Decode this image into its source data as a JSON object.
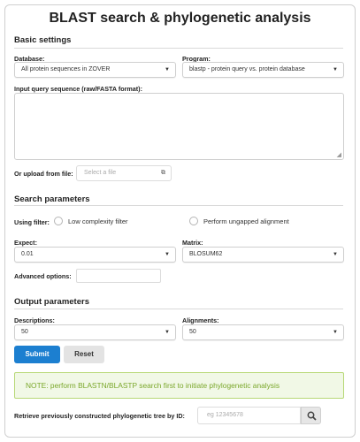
{
  "title": "BLAST search & phylogenetic analysis",
  "basic": {
    "heading": "Basic settings",
    "database_label": "Database:",
    "database_value": "All protein sequences in ZOVER",
    "program_label": "Program:",
    "program_value": "blastp - protein query vs. protein database",
    "query_label": "Input query sequence (raw/FASTA format):",
    "query_value": "",
    "upload_label": "Or upload from file:",
    "upload_placeholder": "Select a file",
    "upload_icon": "copy-icon"
  },
  "search": {
    "heading": "Search parameters",
    "filter_label": "Using filter:",
    "low_complexity_label": "Low complexity filter",
    "low_complexity_checked": false,
    "ungapped_label": "Perform ungapped alignment",
    "ungapped_checked": false,
    "expect_label": "Expect:",
    "expect_value": "0.01",
    "matrix_label": "Matrix:",
    "matrix_value": "BLOSUM62",
    "advanced_label": "Advanced options:",
    "advanced_value": ""
  },
  "output": {
    "heading": "Output parameters",
    "descriptions_label": "Descriptions:",
    "descriptions_value": "50",
    "alignments_label": "Alignments:",
    "alignments_value": "50"
  },
  "buttons": {
    "submit": "Submit",
    "reset": "Reset"
  },
  "note": "NOTE: perform BLASTN/BLASTP search first to initiate phylogenetic analysis",
  "retrieve": {
    "label": "Retrieve previously constructed phylogenetic tree by ID:",
    "placeholder": "eg 12345678",
    "search_icon": "search-icon"
  },
  "colors": {
    "primary": "#1c7fd0",
    "note_text": "#7aa72a",
    "note_bg": "#f1f8e6",
    "note_border": "#b7d876"
  }
}
